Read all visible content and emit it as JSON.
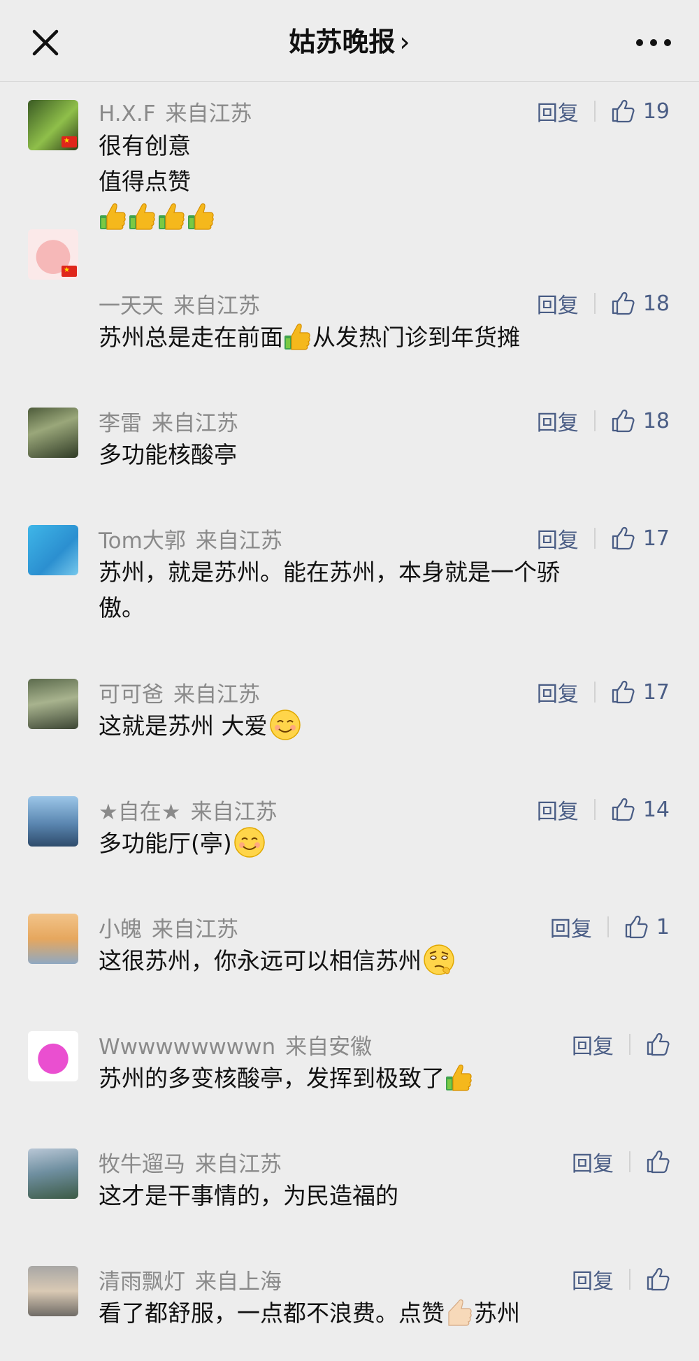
{
  "header": {
    "title": "姑苏晚报",
    "chevron": "›"
  },
  "icons": {
    "close": "close-icon",
    "more": "more-dots-icon",
    "like": "thumb-up-outline-icon",
    "thumb_emoji": "thumbs-up-emoji",
    "smile_emoji": "smiling-face-emoji",
    "raised_eyebrow_emoji": "raised-eyebrow-emoji",
    "flag": "china-flag-icon"
  },
  "reply_label": "回复",
  "comments": [
    {
      "name": "H.X.F",
      "location": "来自江苏",
      "likes": "19",
      "lines": [
        "很有创意",
        "值得点赞",
        ""
      ]
    },
    {
      "name": "一天天",
      "location": "来自江苏",
      "likes": "18",
      "text_a": "苏州总是走在前面",
      "text_b": "从发热门诊到年货摊"
    },
    {
      "name": "李雷",
      "location": "来自江苏",
      "likes": "18",
      "text": "多功能核酸亭"
    },
    {
      "name": "Tom大郭",
      "location": "来自江苏",
      "likes": "17",
      "lines": [
        "苏州，就是苏州。能在苏州，本身就是一个骄",
        "傲。"
      ]
    },
    {
      "name": "可可爸",
      "location": "来自江苏",
      "likes": "17",
      "text": "这就是苏州 大爱"
    },
    {
      "name": "★自在★",
      "location": "来自江苏",
      "likes": "14",
      "text": "多功能厅(亭)"
    },
    {
      "name": "小魄",
      "location": "来自江苏",
      "likes": "1",
      "text": "这很苏州，你永远可以相信苏州"
    },
    {
      "name": "Wwwwwwwwwn",
      "location": "来自安徽",
      "likes": "",
      "text": "苏州的多变核酸亭，发挥到极致了"
    },
    {
      "name": "牧牛遛马",
      "location": "来自江苏",
      "likes": "",
      "text": "这才是干事情的，为民造福的"
    },
    {
      "name": "清雨飘灯",
      "location": "来自上海",
      "likes": "",
      "text_a": "看了都舒服，一点都不浪费。点赞",
      "text_b": "苏州"
    }
  ]
}
